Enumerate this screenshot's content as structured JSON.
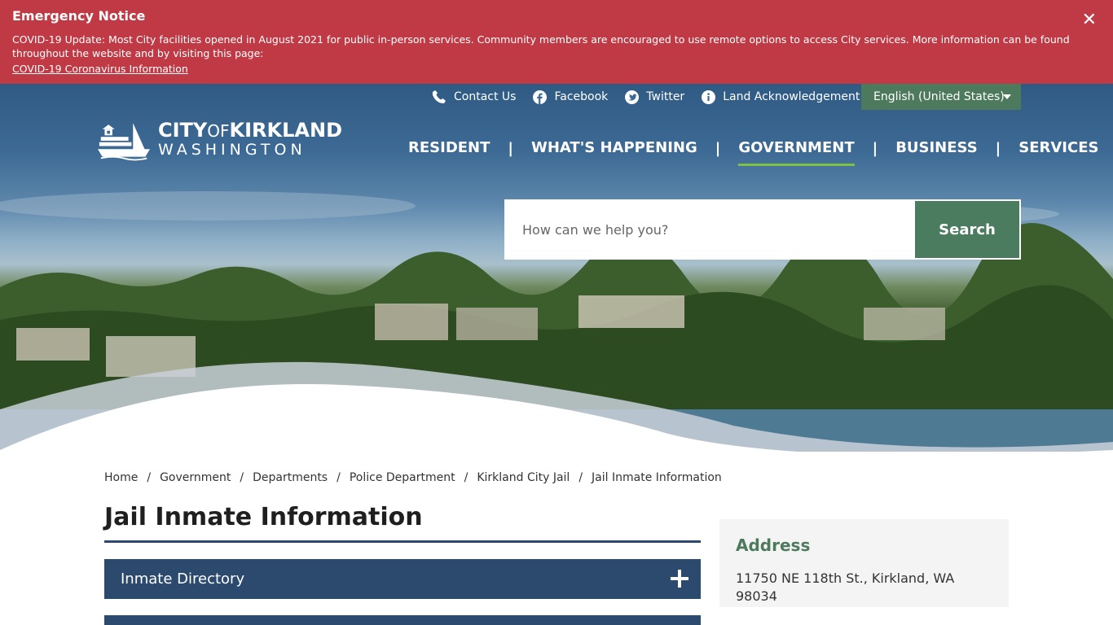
{
  "emergency": {
    "title": "Emergency Notice",
    "body": "COVID-19 Update: Most City facilities opened in August 2021 for public in-person services. Community members are encouraged to use remote options to access City services. More information can be found throughout the website and by visiting this page:",
    "link": "COVID-19 Coronavirus Information",
    "close_glyph": "✕",
    "color": "#bf3a45"
  },
  "utility_nav": [
    {
      "label": "Contact Us",
      "icon": "phone-icon"
    },
    {
      "label": "Facebook",
      "icon": "facebook-icon"
    },
    {
      "label": "Twitter",
      "icon": "twitter-icon"
    },
    {
      "label": "Land Acknowledgement",
      "icon": "info-icon"
    }
  ],
  "language": {
    "selected": "English (United States)"
  },
  "logo": {
    "line1_a": "CITY",
    "line1_b": "OF",
    "line1_c": "KIRKLAND",
    "line2": "WASHINGTON"
  },
  "main_nav": [
    {
      "label": "RESIDENT",
      "active": false
    },
    {
      "label": "WHAT'S HAPPENING",
      "active": false
    },
    {
      "label": "GOVERNMENT",
      "active": true
    },
    {
      "label": "BUSINESS",
      "active": false
    },
    {
      "label": "SERVICES",
      "active": false
    }
  ],
  "nav_separator": "|",
  "search": {
    "placeholder": "How can we help you?",
    "button": "Search"
  },
  "breadcrumb": {
    "items": [
      "Home",
      "Government",
      "Departments",
      "Police Department",
      "Kirkland City Jail"
    ],
    "current": "Jail Inmate Information",
    "separator": "/"
  },
  "page_title": "Jail Inmate Information",
  "accordion": [
    {
      "label": "Inmate Directory"
    },
    {
      "label": ""
    }
  ],
  "sidebar": {
    "title": "Address",
    "text": "11750 NE 118th St., Kirkland, WA  98034"
  },
  "colors": {
    "accent_green": "#4b7c5f",
    "nav_underline": "#7fc241",
    "navy": "#2c4a6e"
  }
}
